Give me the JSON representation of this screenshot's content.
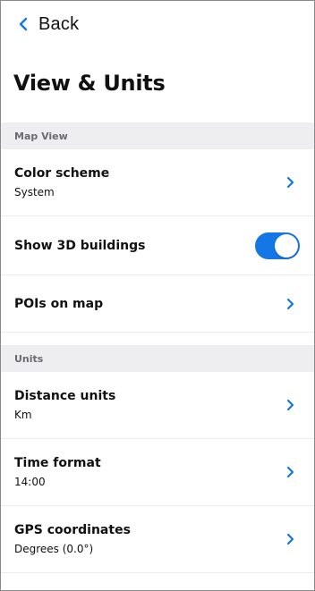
{
  "nav": {
    "back_label": "Back",
    "icon": "chevron-left-icon"
  },
  "page_title": "View & Units",
  "accent_color": "#1577e6",
  "sections": [
    {
      "header": "Map View",
      "rows": [
        {
          "title": "Color scheme",
          "value": "System",
          "control": "chevron-right-icon"
        },
        {
          "title": "Show 3D buildings",
          "control": "toggle",
          "toggle_on": true
        },
        {
          "title": "POIs on map",
          "control": "chevron-right-icon"
        }
      ]
    },
    {
      "header": "Units",
      "rows": [
        {
          "title": "Distance units",
          "value": "Km",
          "control": "chevron-right-icon"
        },
        {
          "title": "Time format",
          "value": "14:00",
          "control": "chevron-right-icon"
        },
        {
          "title": "GPS coordinates",
          "value": "Degrees (0.0°)",
          "control": "chevron-right-icon"
        }
      ]
    }
  ]
}
